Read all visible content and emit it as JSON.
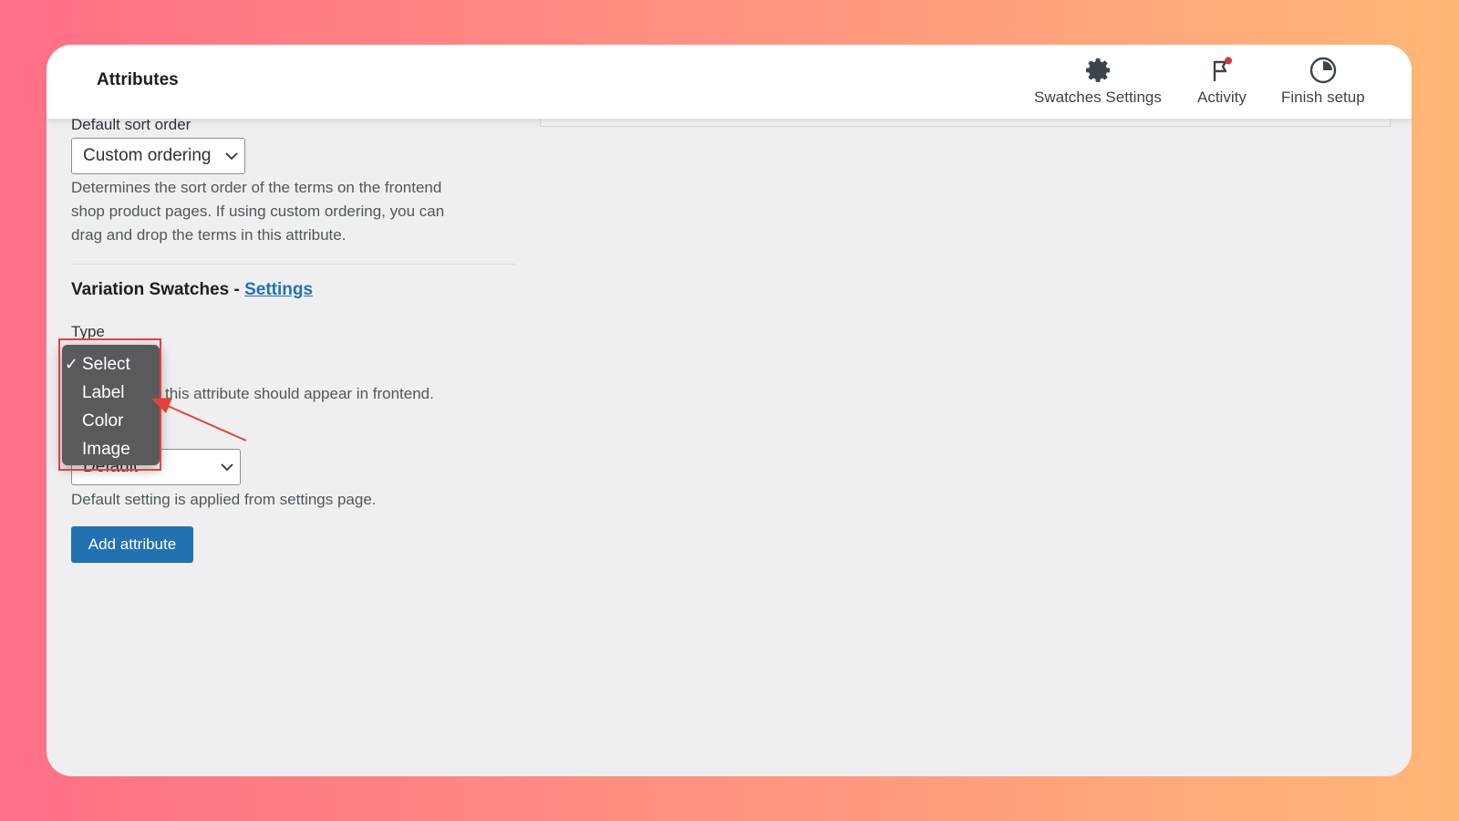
{
  "header": {
    "title": "Attributes",
    "items": [
      {
        "label": "Swatches Settings",
        "icon": "gear-icon"
      },
      {
        "label": "Activity",
        "icon": "flag-icon"
      },
      {
        "label": "Finish setup",
        "icon": "progress-clock-icon"
      }
    ]
  },
  "sort_order": {
    "label": "Default sort order",
    "value": "Custom ordering",
    "description_lines": [
      "Determines the sort order of the terms on the frontend",
      "shop product pages. If using custom ordering, you can",
      "drag and drop the terms in this attribute."
    ]
  },
  "swatches": {
    "title": "Variation Swatches - ",
    "settings_link": "Settings",
    "type_label": "Type",
    "type_description": "this attribute should appear in frontend.",
    "type_options": [
      "Select",
      "Label",
      "Color",
      "Image"
    ],
    "selected_option": "Select",
    "check_mark": "✓",
    "shape_value": "Default",
    "shape_description": "Default setting is applied from settings page."
  },
  "actions": {
    "add_attribute": "Add attribute"
  },
  "colors": {
    "accent": "#2271b1",
    "highlight": "#e8403a",
    "dropdown_bg": "#595a5c",
    "notification_dot": "#d63638"
  }
}
